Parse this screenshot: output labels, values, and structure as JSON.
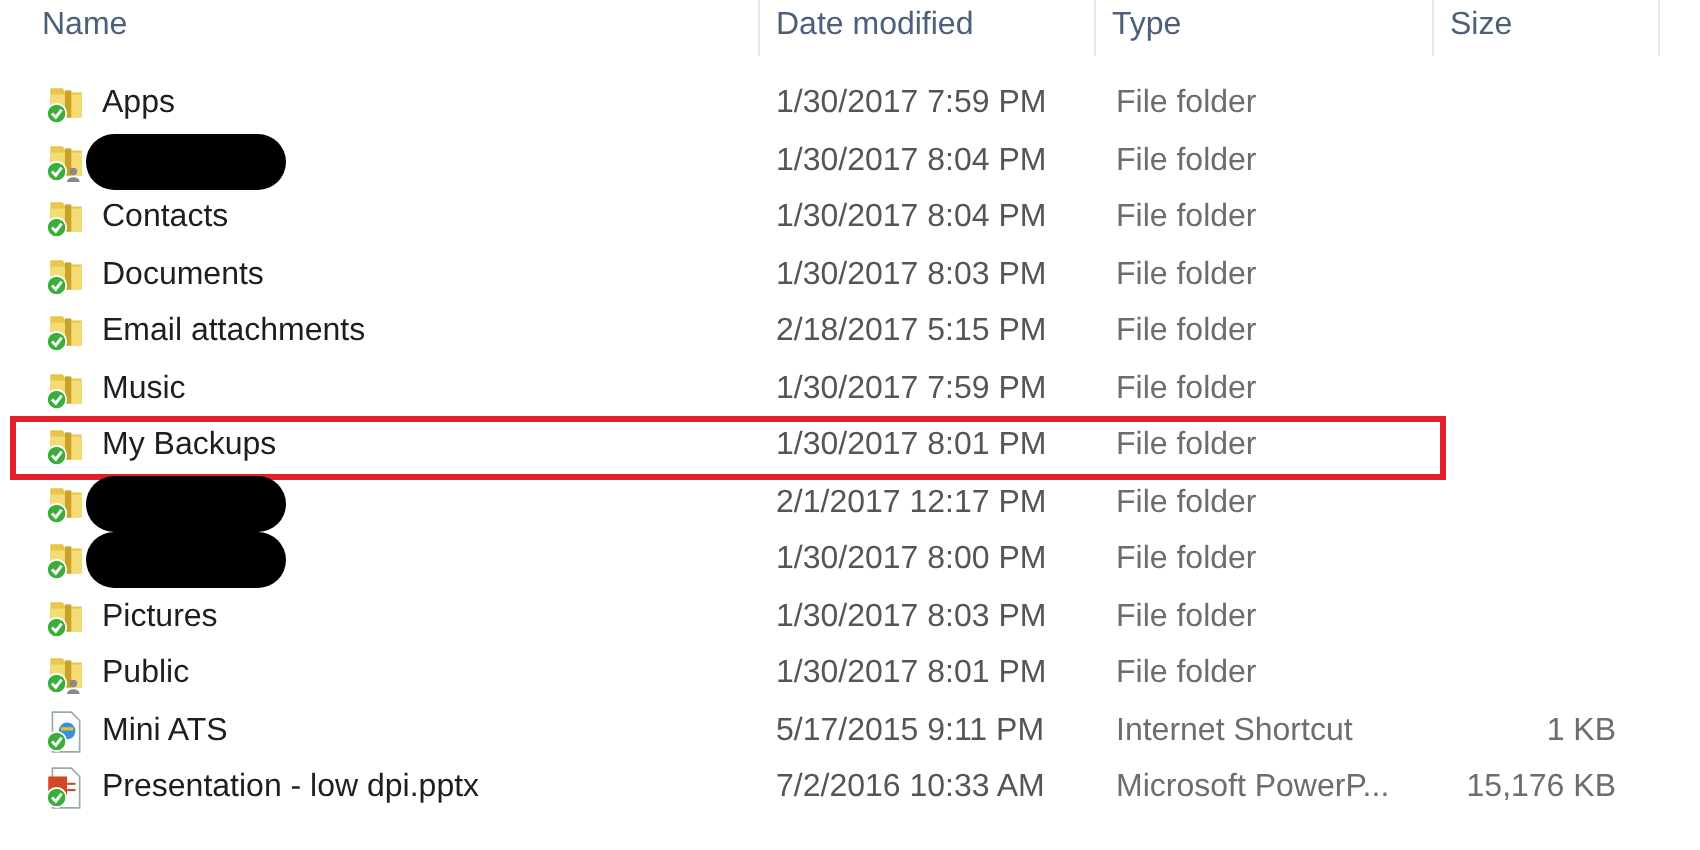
{
  "columns": [
    {
      "label": "Name"
    },
    {
      "label": "Date modified"
    },
    {
      "label": "Type"
    },
    {
      "label": "Size"
    }
  ],
  "rows": [
    {
      "kind": "folder",
      "name": "Apps",
      "date": "1/30/2017 7:59 PM",
      "type": "File folder",
      "highlighted": false
    },
    {
      "kind": "shared-folder",
      "redacted": true,
      "date": "1/30/2017 8:04 PM",
      "type": "File folder",
      "highlighted": false
    },
    {
      "kind": "folder",
      "name": "Contacts",
      "date": "1/30/2017 8:04 PM",
      "type": "File folder",
      "highlighted": false
    },
    {
      "kind": "folder",
      "name": "Documents",
      "date": "1/30/2017 8:03 PM",
      "type": "File folder",
      "highlighted": false
    },
    {
      "kind": "folder",
      "name": "Email attachments",
      "date": "2/18/2017 5:15 PM",
      "type": "File folder",
      "highlighted": false
    },
    {
      "kind": "folder",
      "name": "Music",
      "date": "1/30/2017 7:59 PM",
      "type": "File folder",
      "highlighted": false
    },
    {
      "kind": "folder",
      "name": "My Backups",
      "date": "1/30/2017 8:01 PM",
      "type": "File folder",
      "highlighted": true
    },
    {
      "kind": "folder",
      "redacted": true,
      "date": "2/1/2017 12:17 PM",
      "type": "File folder",
      "highlighted": false
    },
    {
      "kind": "folder",
      "redacted": true,
      "date": "1/30/2017 8:00 PM",
      "type": "File folder",
      "highlighted": false
    },
    {
      "kind": "folder",
      "name": "Pictures",
      "date": "1/30/2017 8:03 PM",
      "type": "File folder",
      "highlighted": false
    },
    {
      "kind": "shared-folder",
      "name": "Public",
      "date": "1/30/2017 8:01 PM",
      "type": "File folder",
      "highlighted": false
    },
    {
      "kind": "shortcut",
      "name": "Mini ATS",
      "date": "5/17/2015 9:11 PM",
      "type": "Internet Shortcut",
      "size": "1 KB",
      "highlighted": false
    },
    {
      "kind": "presentation",
      "name": "Presentation - low dpi.pptx",
      "date": "7/2/2016 10:33 AM",
      "type": "Microsoft PowerP...",
      "size": "15,176 KB",
      "highlighted": false
    }
  ]
}
